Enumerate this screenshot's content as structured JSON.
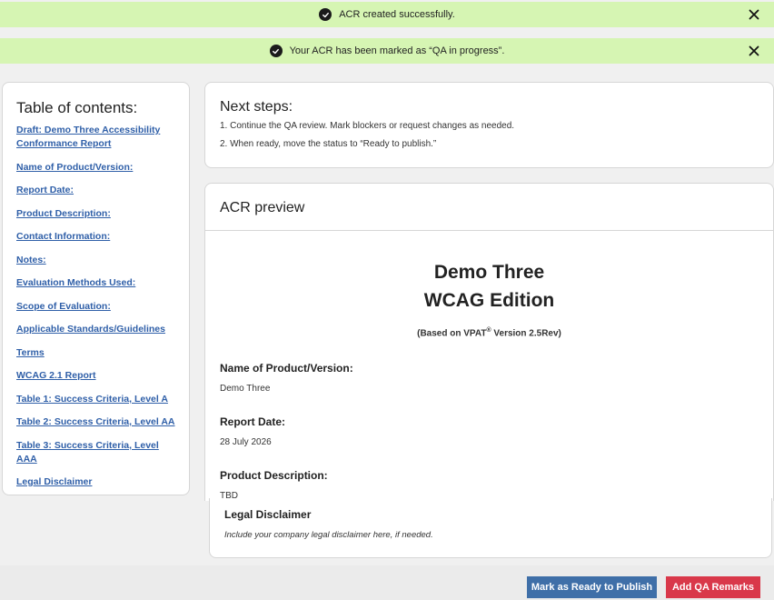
{
  "toasts": [
    {
      "message": "ACR created successfully."
    },
    {
      "message": "Your ACR has been marked as “QA in progress”."
    }
  ],
  "toc": {
    "title": "Table of contents:",
    "items": [
      {
        "label": "Draft: Demo Three Accessibility Conformance Report"
      },
      {
        "label": "Name of Product/Version:"
      },
      {
        "label": "Report Date:"
      },
      {
        "label": "Product Description:"
      },
      {
        "label": "Contact Information:"
      },
      {
        "label": "Notes:"
      },
      {
        "label": "Evaluation Methods Used:"
      },
      {
        "label": "Scope of Evaluation:"
      },
      {
        "label": "Applicable Standards/Guidelines"
      },
      {
        "label": "Terms"
      },
      {
        "label": "WCAG 2.1 Report"
      },
      {
        "label": "Table 1: Success Criteria, Level A"
      },
      {
        "label": "Table 2: Success Criteria, Level AA"
      },
      {
        "label": "Table 3: Success Criteria, Level AAA"
      },
      {
        "label": "Legal Disclaimer"
      }
    ]
  },
  "next_steps": {
    "title": "Next steps:",
    "steps": [
      "1. Continue the QA review. Mark blockers or request changes as needed.",
      "2. When ready, move the status to “Ready to publish.”"
    ]
  },
  "preview": {
    "title": "ACR preview",
    "doc_title_line1": "Demo Three",
    "doc_title_line2": "WCAG Edition",
    "doc_sub_prefix": "(Based on VPAT",
    "doc_sub_reg": "®",
    "doc_sub_suffix": " Version 2.5Rev)",
    "fields": [
      {
        "label": "Name of Product/Version:",
        "value": "Demo Three"
      },
      {
        "label": "Report Date:",
        "value": "28 July 2026"
      },
      {
        "label": "Product Description:",
        "value": "TBD"
      }
    ]
  },
  "disclaimer": {
    "title": "Legal Disclaimer",
    "text": "Include your company legal disclaimer here, if needed."
  },
  "actions": {
    "ready_label": "Mark as Ready to Publish",
    "remarks_label": "Add QA Remarks"
  },
  "colors": {
    "toast_bg": "#d6f5b3",
    "link": "#2f5fa8",
    "primary_button": "#3f6fa8",
    "danger_button": "#d9384a"
  }
}
